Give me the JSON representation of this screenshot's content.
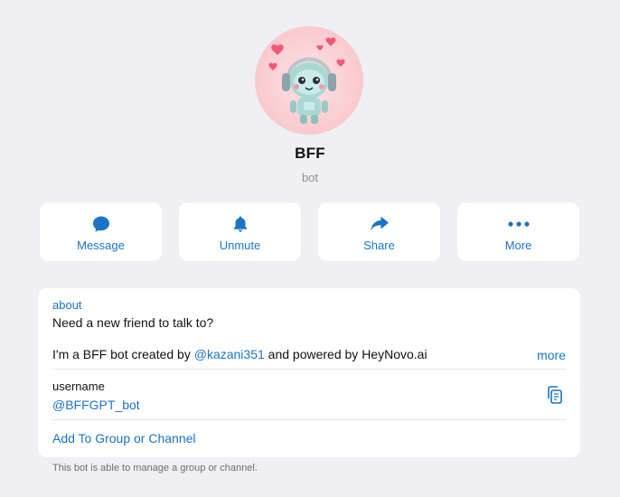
{
  "profile": {
    "name": "BFF",
    "subtitle": "bot",
    "avatar_description_icon": "robot-with-headphones-and-hearts-avatar"
  },
  "actions": [
    {
      "label": "Message",
      "icon": "message-bubble-icon"
    },
    {
      "label": "Unmute",
      "icon": "bell-icon"
    },
    {
      "label": "Share",
      "icon": "share-arrow-icon"
    },
    {
      "label": "More",
      "icon": "more-dots-icon"
    }
  ],
  "info": {
    "about_label": "about",
    "about_line1": "Need a new friend to talk to?",
    "about_line2_prefix": "I'm a BFF bot created by ",
    "about_line2_mention": "@kazani351",
    "about_line2_suffix": " and powered by HeyNovo.ai",
    "more_label": "more",
    "username_label": "username",
    "username_value": "@BFFGPT_bot",
    "add_group_label": "Add To Group or Channel"
  },
  "footnote": "This bot is able to manage a group or channel.",
  "colors": {
    "accent": "#1c73c7",
    "background": "#efeff4",
    "card": "#ffffff",
    "avatar_bg": "#fbd3d6"
  }
}
